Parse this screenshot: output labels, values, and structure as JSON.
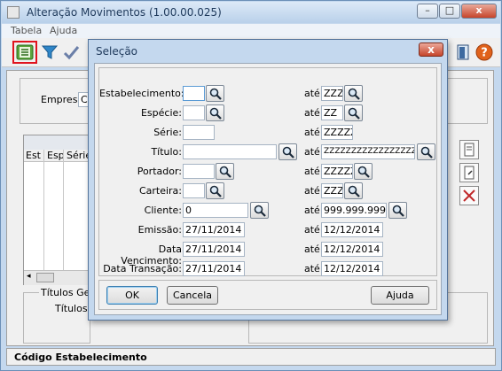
{
  "main_window": {
    "title": "Alteração Movimentos (1.00.00.025)",
    "menu": [
      "Tabela",
      "Ajuda"
    ],
    "empresa_label": "Empresa:",
    "empresa_value": "CE",
    "grid_headers": [
      "Est",
      "Esp",
      "Série"
    ],
    "bottom_group_title": "Títulos Gera",
    "bottom_label": "Títulos S",
    "status_text": "Código Estabelecimento"
  },
  "dialog": {
    "title": "Seleção",
    "fields": [
      {
        "label": "Estabelecimento:",
        "from": "",
        "to": "ZZZ"
      },
      {
        "label": "Espécie:",
        "from": "",
        "to": "ZZ"
      },
      {
        "label": "Série:",
        "from": "",
        "to": "ZZZZZ"
      },
      {
        "label": "Título:",
        "from": "",
        "to": "ZZZZZZZZZZZZZZZZZZZ"
      },
      {
        "label": "Portador:",
        "from": "",
        "to": "ZZZZZ"
      },
      {
        "label": "Carteira:",
        "from": "",
        "to": "ZZZ"
      },
      {
        "label": "Cliente:",
        "from": "0",
        "to": "999.999.999"
      },
      {
        "label": "Emissão:",
        "from": "27/11/2014",
        "to": "12/12/2014"
      },
      {
        "label": "Data Vencimento:",
        "from": "27/11/2014",
        "to": "12/12/2014"
      },
      {
        "label": "Data Transação:",
        "from": "27/11/2014",
        "to": "12/12/2014"
      }
    ],
    "ate_label": "até:",
    "buttons": {
      "ok": "OK",
      "cancel": "Cancela",
      "help": "Ajuda"
    },
    "close_glyph": "x"
  },
  "colors": {
    "highlight_red": "#e0141e",
    "accent": "#3c7fb1"
  }
}
